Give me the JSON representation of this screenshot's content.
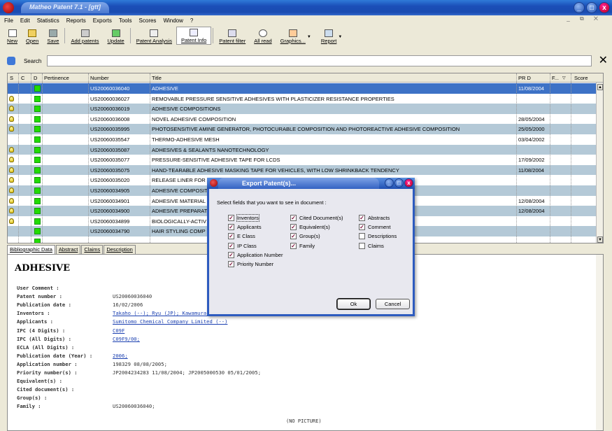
{
  "window": {
    "title": "Matheo Patent 7.1 - [gtt]",
    "controls": [
      "_",
      "□",
      "x"
    ]
  },
  "menu": {
    "items": [
      "File",
      "Edit",
      "Statistics",
      "Reports",
      "Exports",
      "Tools",
      "Scores",
      "Window",
      "?"
    ],
    "right_controls": "_ ⧉ ✕"
  },
  "toolbar": {
    "buttons": [
      {
        "label": "New",
        "icon": "new-document-icon"
      },
      {
        "label": "Open",
        "icon": "open-folder-icon"
      },
      {
        "label": "Save",
        "icon": "save-disk-icon"
      },
      {
        "label": "Add patents",
        "icon": "add-patents-icon"
      },
      {
        "label": "Update",
        "icon": "update-icon"
      },
      {
        "label": "Patent Analysis",
        "icon": "patent-analysis-icon"
      },
      {
        "label": "Patent Info",
        "icon": "patent-info-icon"
      },
      {
        "label": "Patent filter",
        "icon": "patent-filter-icon"
      },
      {
        "label": "All read",
        "icon": "all-read-icon"
      },
      {
        "label": "Graphics...",
        "icon": "graphics-icon"
      },
      {
        "label": "Report",
        "icon": "report-icon"
      }
    ]
  },
  "search": {
    "label": "Search",
    "value": "",
    "close": "✕"
  },
  "grid": {
    "columns": [
      "S",
      "C",
      "D",
      "Pertinence",
      "Number",
      "Title",
      "PR D",
      "F...",
      "Score"
    ],
    "rows": [
      {
        "number": "US20060036040",
        "title": "ADHESIVE",
        "prd": "11/08/2004",
        "bulb": false,
        "dot": true,
        "style": "sel"
      },
      {
        "number": "US20060036027",
        "title": "REMOVABLE PRESSURE SENSITIVE ADHESIVES WITH PLASTICIZER RESISTANCE PROPERTIES",
        "prd": "",
        "bulb": true,
        "dot": true,
        "style": ""
      },
      {
        "number": "US20060036019",
        "title": "ADHESIVE COMPOSITIONS",
        "prd": "",
        "bulb": true,
        "dot": true,
        "style": "alt"
      },
      {
        "number": "US20060036008",
        "title": "NOVEL ADHESIVE COMPOSITION",
        "prd": "28/05/2004",
        "bulb": true,
        "dot": true,
        "style": ""
      },
      {
        "number": "US20060035995",
        "title": "PHOTOSENSITIVE AMINE GENERATOR, PHOTOCURABLE COMPOSITION AND PHOTOREACTIVE ADHESIVE COMPOSITION",
        "prd": "25/05/2000",
        "bulb": true,
        "dot": true,
        "style": "alt"
      },
      {
        "number": "US20060035547",
        "title": "THERMO-ADHESIVE MESH",
        "prd": "03/04/2002",
        "bulb": false,
        "dot": true,
        "style": ""
      },
      {
        "number": "US20060035087",
        "title": "ADHESIVES & SEALANTS NANOTECHNOLOGY",
        "prd": "",
        "bulb": true,
        "dot": true,
        "style": "alt"
      },
      {
        "number": "US20060035077",
        "title": "PRESSURE-SENSITIVE ADHESIVE TAPE FOR LCDS",
        "prd": "17/09/2002",
        "bulb": true,
        "dot": true,
        "style": ""
      },
      {
        "number": "US20060035075",
        "title": "HAND-TEARABLE ADHESIVE MASKING TAPE FOR VEHICLES, WITH LOW SHRINKBACK TENDENCY",
        "prd": "11/08/2004",
        "bulb": true,
        "dot": true,
        "style": "alt"
      },
      {
        "number": "US20060035020",
        "title": "RELEASE LINER FOR",
        "prd": "",
        "bulb": true,
        "dot": true,
        "style": ""
      },
      {
        "number": "US20060034905",
        "title": "ADHESIVE COMPOSIT",
        "prd": "",
        "bulb": true,
        "dot": true,
        "style": "alt"
      },
      {
        "number": "US20060034901",
        "title": "ADHESIVE MATERIAL",
        "prd": "12/08/2004",
        "bulb": true,
        "dot": true,
        "style": ""
      },
      {
        "number": "US20060034900",
        "title": "ADHESIVE PREPARAT",
        "prd": "12/08/2004",
        "bulb": true,
        "dot": true,
        "style": "alt"
      },
      {
        "number": "US20060034899",
        "title": "BIOLOGICALLY-ACTIV",
        "prd": "",
        "bulb": true,
        "dot": true,
        "style": ""
      },
      {
        "number": "US20060034790",
        "title": "HAIR STYLING COMP",
        "prd": "",
        "bulb": false,
        "dot": true,
        "style": "alt"
      },
      {
        "number": "",
        "title": "",
        "prd": "",
        "bulb": false,
        "dot": true,
        "style": ""
      }
    ]
  },
  "detail_tabs": [
    "Bibliographic Data",
    "Abstract",
    "Claims",
    "Description"
  ],
  "detail": {
    "title": "ADHESIVE",
    "fields": [
      {
        "label": "User Comment :",
        "value": "",
        "link": false
      },
      {
        "label": "Patent number :",
        "value": "US20060036040",
        "link": false
      },
      {
        "label": "Publication date :",
        "value": "16/02/2006",
        "link": false
      },
      {
        "label": "Inventors :",
        "value": "Takaho (--); Ryu (JP); Kawamura (--",
        "link": true
      },
      {
        "label": "Applicants :",
        "value": "Sumitomo Chemical Company Limited (--)",
        "link": true
      },
      {
        "label": "IPC (4 Digits) :",
        "value": "C09F",
        "link": true
      },
      {
        "label": "IPC (All Digits) :",
        "value": "C09F9/00;",
        "link": true
      },
      {
        "label": "ECLA (All Digits) :",
        "value": "",
        "link": false
      },
      {
        "label": "Publication date (Year) :",
        "value": "2006;",
        "link": true
      },
      {
        "label": "Application number :",
        "value": "198329 08/08/2005;",
        "link": false
      },
      {
        "label": "Priority number(s) :",
        "value": "JP2004234283 11/08/2004; JP2005000530 05/01/2005;",
        "link": false
      },
      {
        "label": "Equivalent(s) :",
        "value": "",
        "link": false
      },
      {
        "label": "Cited document(s) :",
        "value": "",
        "link": false
      },
      {
        "label": "Group(s) :",
        "value": "",
        "link": false
      },
      {
        "label": "Family :",
        "value": "US20060036040;",
        "link": false
      }
    ],
    "no_picture": "(NO PICTURE)"
  },
  "dialog": {
    "title": "Export Patent(s)...",
    "prompt": "Select fields that you want to see in document :",
    "col1": [
      {
        "label": "Inventors",
        "checked": true
      },
      {
        "label": "Applicants",
        "checked": true
      },
      {
        "label": "E Class",
        "checked": true
      },
      {
        "label": "IP Class",
        "checked": true
      },
      {
        "label": "Application Number",
        "checked": true
      },
      {
        "label": "Priority Number",
        "checked": true
      }
    ],
    "col2": [
      {
        "label": "Cited Document(s)",
        "checked": true
      },
      {
        "label": "Equivalent(s)",
        "checked": true
      },
      {
        "label": "Group(s)",
        "checked": true
      },
      {
        "label": "Family",
        "checked": true
      }
    ],
    "col3": [
      {
        "label": "Abstracts",
        "checked": true
      },
      {
        "label": "Comment",
        "checked": true
      },
      {
        "label": "Descriptions",
        "checked": false
      },
      {
        "label": "Claims",
        "checked": false
      }
    ],
    "ok": "Ok",
    "cancel": "Cancel"
  },
  "colors": {
    "selected_row": "#3d72c6",
    "alt_row": "#b4c9d7",
    "status_dot": "#22dd00",
    "titlebar": "#1b4fb8"
  }
}
